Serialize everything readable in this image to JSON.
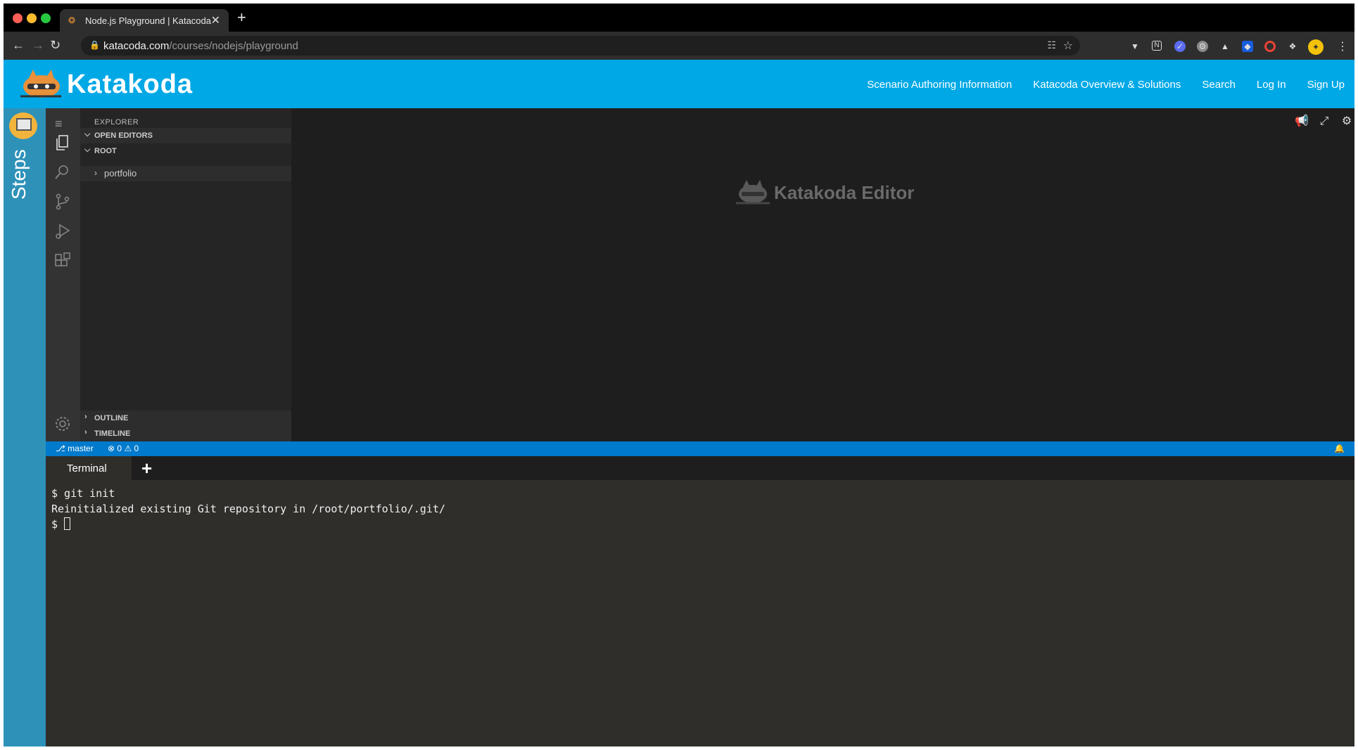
{
  "browser": {
    "tab_title": "Node.js Playground | Katacoda",
    "url_host": "katacoda.com",
    "url_path": "/courses/nodejs/playground",
    "new_tab_label": "+"
  },
  "header": {
    "brand": "Katakoda",
    "nav": [
      "Scenario Authoring Information",
      "Katacoda Overview & Solutions",
      "Search",
      "Log In",
      "Sign Up"
    ]
  },
  "steps": {
    "label": "Steps"
  },
  "explorer": {
    "title": "EXPLORER",
    "open_editors": "OPEN EDITORS",
    "root": "ROOT",
    "folder": "portfolio",
    "outline": "OUTLINE",
    "timeline": "TIMELINE"
  },
  "editor": {
    "watermark": "Katakoda Editor"
  },
  "statusbar": {
    "branch": "master",
    "errors": "0",
    "warnings": "0"
  },
  "terminal": {
    "tab_label": "Terminal",
    "lines": [
      "$ git init",
      "Reinitialized existing Git repository in /root/portfolio/.git/",
      "$ "
    ]
  },
  "colors": {
    "katacoda_blue": "#00a8e6",
    "steps_blue": "#2e91b8",
    "status_blue": "#007acc"
  }
}
